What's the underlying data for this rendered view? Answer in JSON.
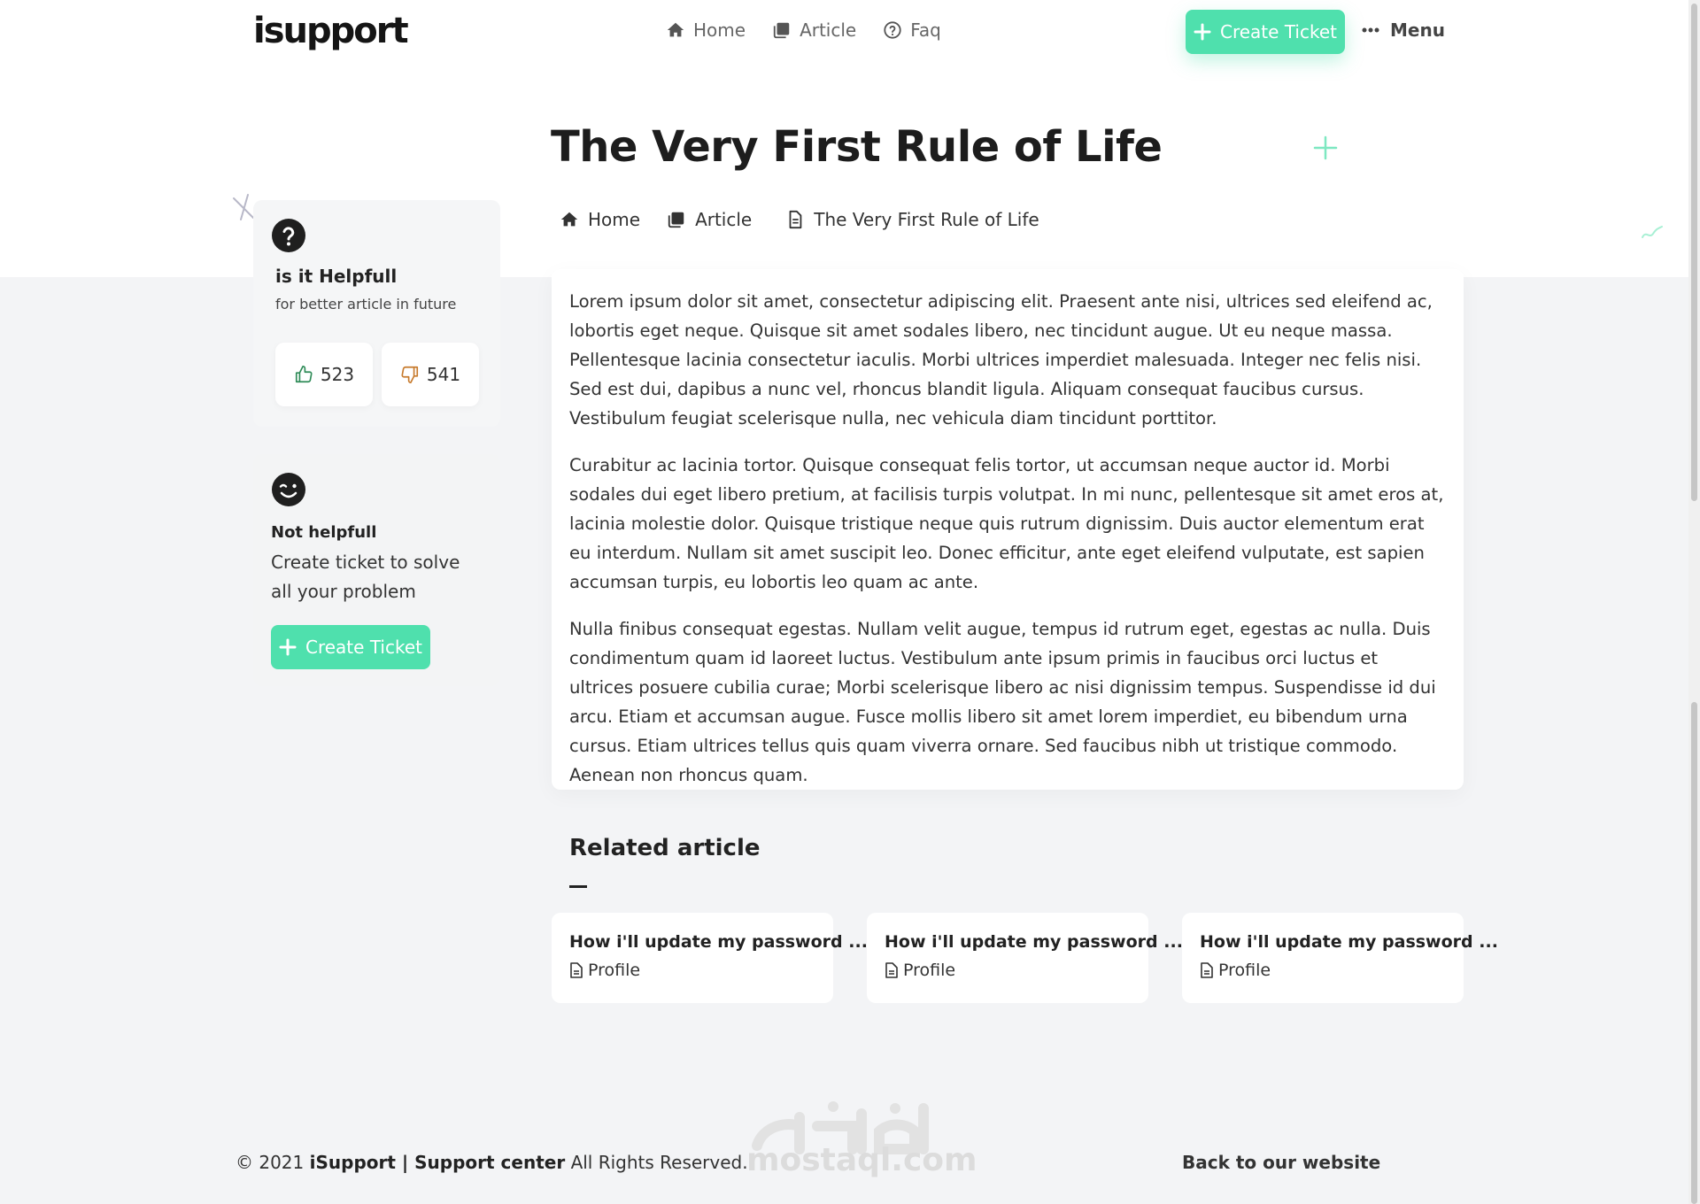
{
  "brand": {
    "logo": "isupport",
    "accent": "#4fe0ad"
  },
  "nav": {
    "links": [
      {
        "label": "Home",
        "icon": "home-icon"
      },
      {
        "label": "Article",
        "icon": "article-icon"
      },
      {
        "label": "Faq",
        "icon": "question-circle-icon"
      }
    ],
    "create_ticket": "Create Ticket",
    "menu": "Menu"
  },
  "page": {
    "title": "The Very First Rule of Life"
  },
  "breadcrumb": [
    {
      "label": "Home",
      "icon": "home-icon"
    },
    {
      "label": "Article",
      "icon": "article-icon"
    },
    {
      "label": "The Very First Rule of Life",
      "icon": "document-icon"
    }
  ],
  "helpful": {
    "title": "is it Helpfull",
    "subtitle": "for better article in future",
    "likes": "523",
    "dislikes": "541"
  },
  "not_helpful": {
    "title": "Not helpfull",
    "text": "Create ticket to solve all your problem",
    "button": "Create Ticket"
  },
  "article": {
    "paragraphs": [
      "Lorem ipsum dolor sit amet, consectetur adipiscing elit. Praesent ante nisi, ultrices sed eleifend ac, lobortis eget neque. Quisque sit amet sodales libero, nec tincidunt augue. Ut eu neque massa. Pellentesque lacinia consectetur iaculis. Morbi ultrices imperdiet malesuada. Integer nec felis nisi. Sed est dui, dapibus a nunc vel, rhoncus blandit ligula. Aliquam consequat faucibus cursus. Vestibulum feugiat scelerisque nulla, nec vehicula diam tincidunt porttitor.",
      "Curabitur ac lacinia tortor. Quisque consequat felis tortor, ut accumsan neque auctor id. Morbi sodales dui eget libero pretium, at facilisis turpis volutpat. In mi nunc, pellentesque sit amet eros at, lacinia molestie dolor. Quisque tristique neque quis rutrum dignissim. Duis auctor elementum erat eu interdum. Nullam sit amet suscipit leo. Donec efficitur, ante eget eleifend vulputate, est sapien accumsan turpis, eu lobortis leo quam ac ante.",
      "Nulla finibus consequat egestas. Nullam velit augue, tempus id rutrum eget, egestas ac nulla. Duis condimentum quam id laoreet luctus. Vestibulum ante ipsum primis in faucibus orci luctus et ultrices posuere cubilia curae; Morbi scelerisque libero ac nisi dignissim tempus. Suspendisse id dui arcu. Etiam et accumsan augue. Fusce mollis libero sit amet lorem imperdiet, eu bibendum urna cursus. Etiam ultrices tellus quis quam viverra ornare. Sed faucibus nibh ut tristique commodo. Aenean non rhoncus quam."
    ]
  },
  "related": {
    "title": "Related article",
    "items": [
      {
        "title": "How i'll update my password ...",
        "category": "Profile"
      },
      {
        "title": "How i'll update my password ...",
        "category": "Profile"
      },
      {
        "title": "How i'll update my password ...",
        "category": "Profile"
      }
    ]
  },
  "footer": {
    "copy_prefix": "© 2021",
    "copy_brand": "iSupport | Support center",
    "copy_suffix": "All Rights Reserved.",
    "back": "Back to our website"
  },
  "watermark": {
    "arabic": "مستقل",
    "latin": "mostaql.com"
  }
}
